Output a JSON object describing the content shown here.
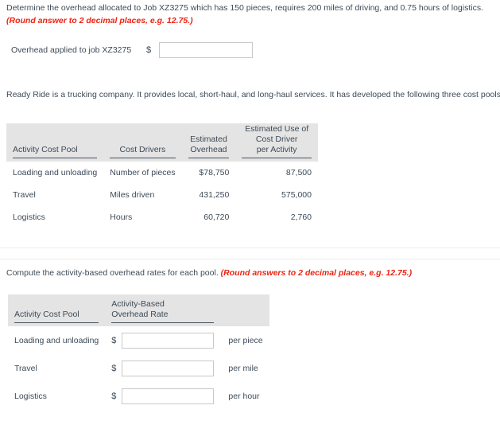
{
  "question1": {
    "text_main": "Determine the overhead allocated to Job XZ3275 which has 150 pieces, requires 200 miles of driving, and 0.75 hours of logistics.",
    "text_note": "(Round answer to 2 decimal places, e.g. 12.75.)",
    "answer_label": "Overhead applied to job XZ3275",
    "currency_symbol": "$",
    "answer_value": "",
    "answer_placeholder": ""
  },
  "intro": {
    "text": "Ready Ride is a trucking company. It provides local, short-haul, and long-haul services. It has developed the following three cost pools."
  },
  "cost_pool_table": {
    "headers": [
      "Activity Cost Pool",
      "Cost Drivers",
      "Estimated\nOverhead",
      "Estimated Use of\nCost Driver\nper Activity"
    ],
    "header_lines": {
      "col1": [
        "Activity Cost Pool"
      ],
      "col2": [
        "Cost Drivers"
      ],
      "col3": [
        "Estimated",
        "Overhead"
      ],
      "col4": [
        "Estimated Use of",
        "Cost Driver",
        "per Activity"
      ]
    },
    "rows": [
      {
        "activity_cost_pool": "Loading and unloading",
        "cost_driver": "Number of pieces",
        "estimated_overhead": "$78,750",
        "estimated_use": "87,500"
      },
      {
        "activity_cost_pool": "Travel",
        "cost_driver": "Miles driven",
        "estimated_overhead": "431,250",
        "estimated_use": "575,000"
      },
      {
        "activity_cost_pool": "Logistics",
        "cost_driver": "Hours",
        "estimated_overhead": "60,720",
        "estimated_use": "2,760"
      }
    ]
  },
  "question2": {
    "text_main": "Compute the activity-based overhead rates for each pool.",
    "text_note": "(Round answers to 2 decimal places, e.g. 12.75.)"
  },
  "rate_table": {
    "header_lines": {
      "col1": [
        "Activity Cost Pool"
      ],
      "col2": [
        "Activity-Based",
        "Overhead Rate"
      ]
    },
    "rows": [
      {
        "activity_cost_pool": "Loading and unloading",
        "currency_symbol": "$",
        "value": "",
        "placeholder": "",
        "unit": "per piece"
      },
      {
        "activity_cost_pool": "Travel",
        "currency_symbol": "$",
        "value": "",
        "placeholder": "",
        "unit": "per mile"
      },
      {
        "activity_cost_pool": "Logistics",
        "currency_symbol": "$",
        "value": "",
        "placeholder": "",
        "unit": "per hour"
      }
    ]
  },
  "colors": {
    "note_red": "#ee2211",
    "text": "#3d4a57",
    "header_band": "#e4e4e4",
    "rule": "#ececec"
  }
}
